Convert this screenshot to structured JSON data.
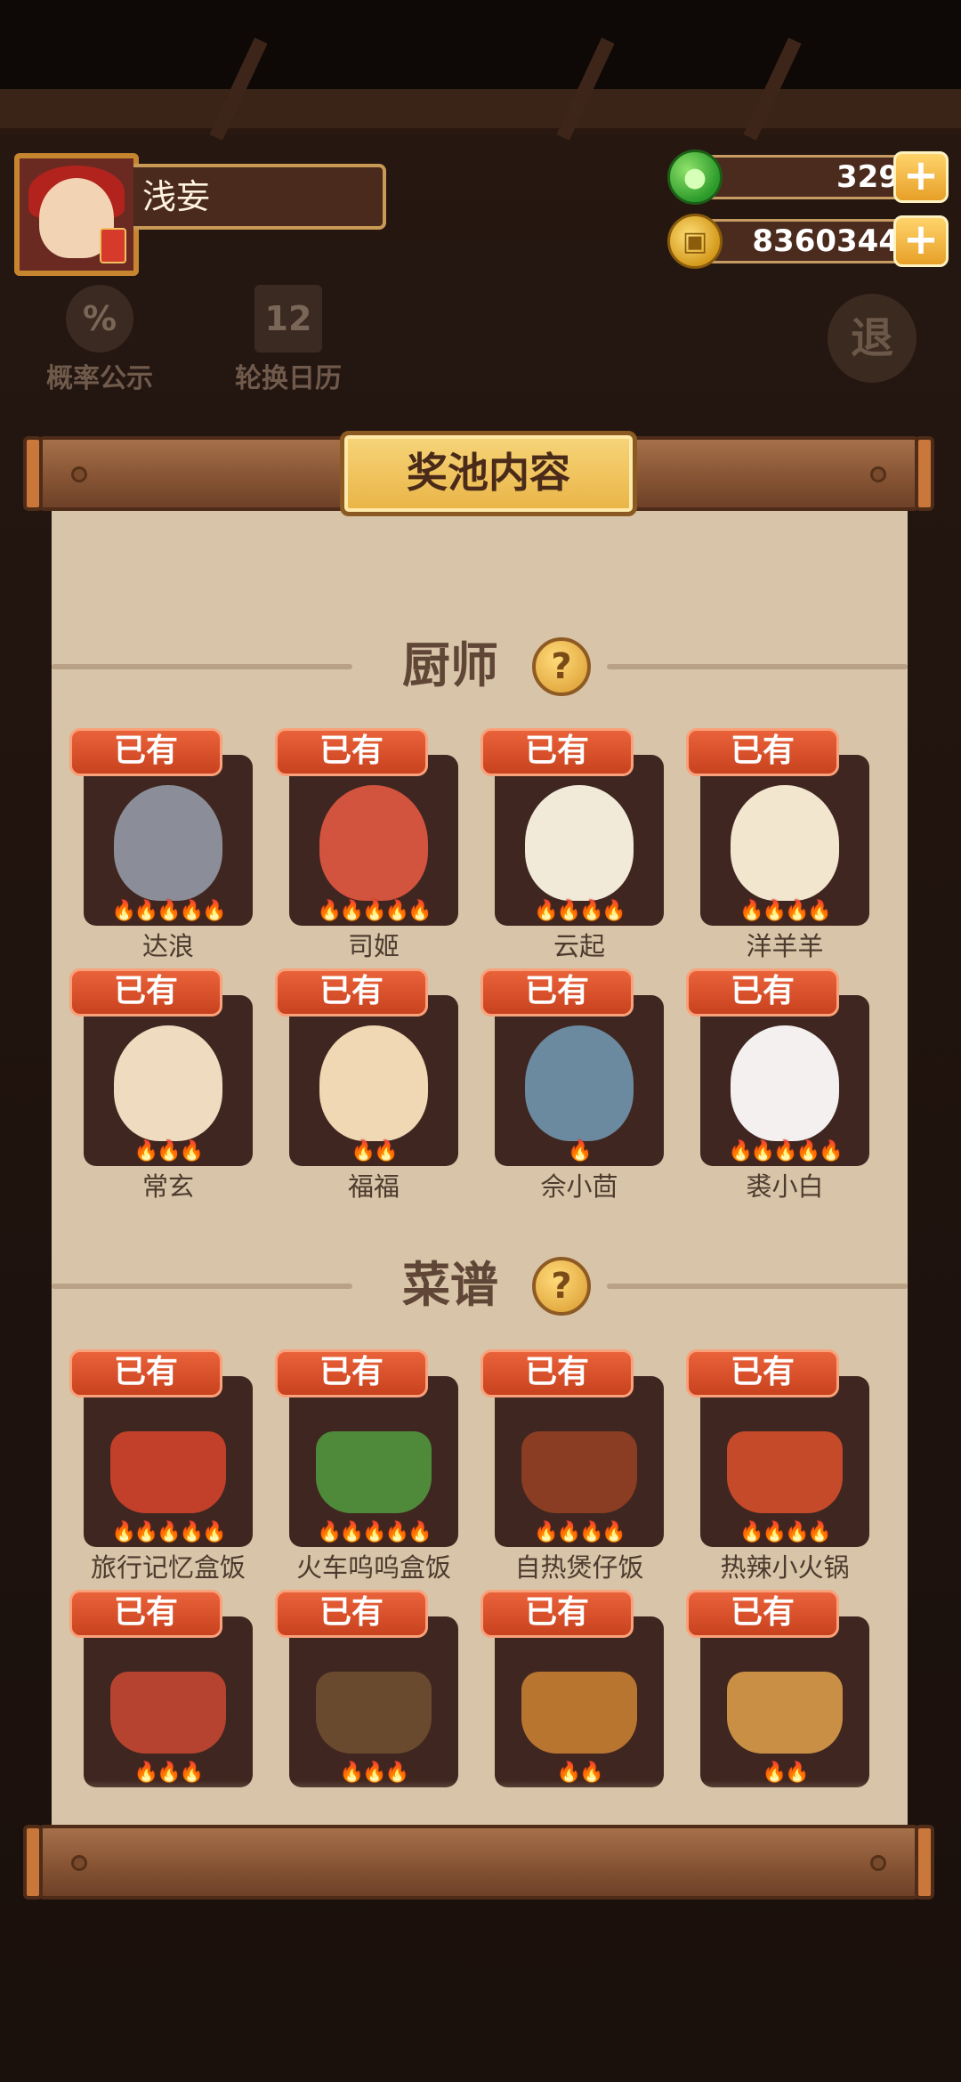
{
  "player": {
    "name": "浅妄"
  },
  "currency": {
    "gems": "329",
    "coins": "8360344",
    "gem_icon": "green-peach-icon",
    "coin_icon": "copper-coin-icon"
  },
  "side_buttons": {
    "probability": "概率公示",
    "calendar": "轮换日历",
    "exit": "退",
    "probability_icon": "%",
    "calendar_icon": "12"
  },
  "panel": {
    "title": "奖池内容"
  },
  "sections": {
    "chefs": {
      "title": "厨师",
      "help": "?"
    },
    "recipes": {
      "title": "菜谱",
      "help": "?"
    }
  },
  "owned_label": "已有",
  "chefs": [
    {
      "name": "达浪",
      "flames": "🔥🔥🔥🔥🔥",
      "color": "#8b8e98"
    },
    {
      "name": "司姬",
      "flames": "🔥🔥🔥🔥🔥",
      "color": "#d2533e"
    },
    {
      "name": "云起",
      "flames": "🔥🔥🔥🔥",
      "color": "#f1ead8"
    },
    {
      "name": "洋羊羊",
      "flames": "🔥🔥🔥🔥",
      "color": "#f3e6cf"
    },
    {
      "name": "常玄",
      "flames": "🔥🔥🔥",
      "color": "#efdcc0"
    },
    {
      "name": "福福",
      "flames": "🔥🔥",
      "color": "#f0d8b4"
    },
    {
      "name": "佘小茴",
      "flames": "🔥",
      "color": "#6b8aa0"
    },
    {
      "name": "裘小白",
      "flames": "🔥🔥🔥🔥🔥",
      "color": "#f4f0f0"
    }
  ],
  "recipes": [
    {
      "name": "旅行记忆盒饭",
      "flames": "🔥🔥🔥🔥🔥",
      "color": "#c2402a"
    },
    {
      "name": "火车呜呜盒饭",
      "flames": "🔥🔥🔥🔥🔥",
      "color": "#4f8a3a"
    },
    {
      "name": "自热煲仔饭",
      "flames": "🔥🔥🔥🔥",
      "color": "#8a3d22"
    },
    {
      "name": "热辣小火锅",
      "flames": "🔥🔥🔥🔥",
      "color": "#c44a2a"
    },
    {
      "name": "",
      "flames": "🔥🔥🔥",
      "color": "#b6432f"
    },
    {
      "name": "",
      "flames": "🔥🔥🔥",
      "color": "#6a4a2e"
    },
    {
      "name": "",
      "flames": "🔥🔥",
      "color": "#b87530"
    },
    {
      "name": "",
      "flames": "🔥🔥",
      "color": "#c98f45"
    }
  ]
}
